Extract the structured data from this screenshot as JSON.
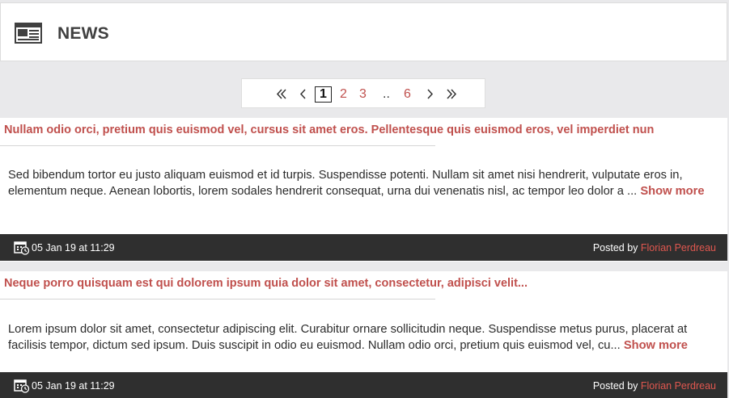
{
  "header": {
    "title": "NEWS",
    "icon": "newspaper-icon"
  },
  "pagination": {
    "first_icon": "double-chevron-left-icon",
    "prev_icon": "chevron-left-icon",
    "pages": [
      "1",
      "2",
      "3"
    ],
    "ellipsis": "..",
    "last_page": "6",
    "next_icon": "chevron-right-icon",
    "last_icon": "double-chevron-right-icon",
    "current": "1"
  },
  "articles": [
    {
      "title": "Nullam odio orci, pretium quis euismod vel, cursus sit amet eros. Pellentesque quis euismod eros, vel imperdiet nun",
      "excerpt": "Sed bibendum tortor eu justo aliquam euismod et id turpis. Suspendisse potenti. Nullam sit amet nisi hendrerit, vulputate eros in, elementum neque. Aenean lobortis, lorem sodales hendrerit consequat, urna dui venenatis nisl, ac tempor leo dolor a ... ",
      "show_more": "Show more",
      "date": "05 Jan 19 at 11:29",
      "posted_by": "Posted by ",
      "author": "Florian Perdreau"
    },
    {
      "title": "Neque porro quisquam est qui dolorem ipsum quia dolor sit amet, consectetur, adipisci velit...",
      "excerpt": "Lorem ipsum dolor sit amet, consectetur adipiscing elit. Curabitur ornare sollicitudin neque. Suspendisse metus purus, placerat at facilisis tempor, dictum sed ipsum. Duis suscipit in odio eu euismod. Nullam odio orci, pretium quis euismod vel, cu... ",
      "show_more": "Show more",
      "date": "05 Jan 19 at 11:29",
      "posted_by": "Posted by ",
      "author": "Florian Perdreau"
    }
  ],
  "colors": {
    "accent": "#c0504d",
    "footer_bg": "#2f2f2f",
    "page_bg": "#e9e9eb"
  }
}
